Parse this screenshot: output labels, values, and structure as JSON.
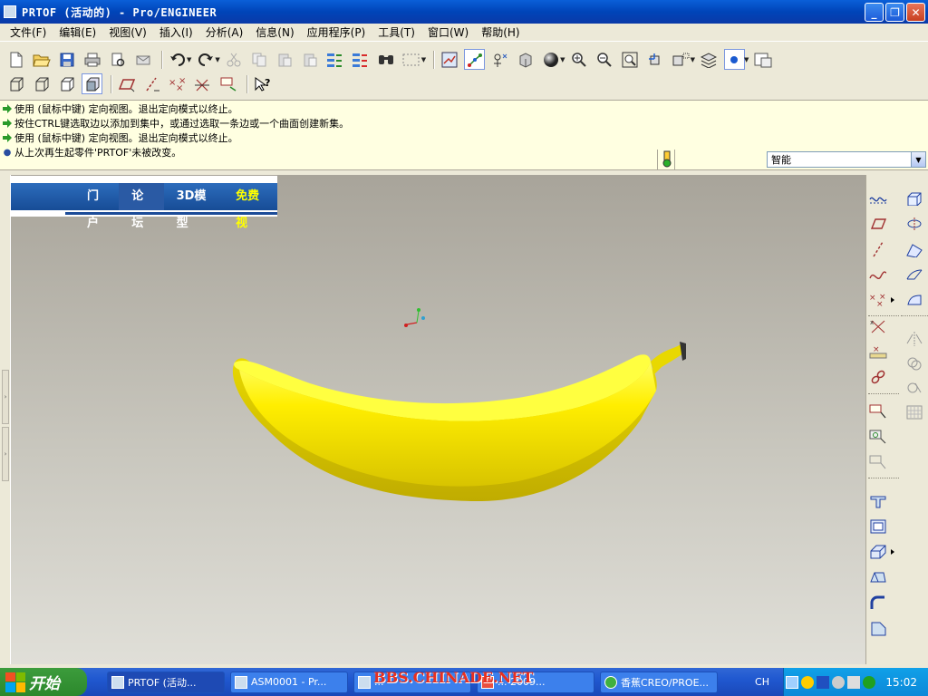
{
  "window": {
    "title": "PRTOF (活动的) - Pro/ENGINEER"
  },
  "menu": [
    "文件(F)",
    "编辑(E)",
    "视图(V)",
    "插入(I)",
    "分析(A)",
    "信息(N)",
    "应用程序(P)",
    "工具(T)",
    "窗口(W)",
    "帮助(H)"
  ],
  "messages": {
    "m1": "使用 (鼠标中键) 定向视图。退出定向模式以终止。",
    "m2": "按住CTRL键选取边以添加到集中，或通过选取一条边或一个曲面创建新集。",
    "m3": "使用 (鼠标中键) 定向视图。退出定向模式以终止。",
    "m4": "从上次再生起零件'PRTOF'未被改变。"
  },
  "filter": {
    "value": "智能"
  },
  "banner": {
    "i1": "门户",
    "i2": "论坛",
    "i3": "3D模型",
    "i4": "免费视"
  },
  "taskbar": {
    "start": "开始",
    "t1": "PRTOF (活动...",
    "t2": "ASM0001 - Pr...",
    "t3": "...",
    "t4": "... 2009...",
    "t5": "香蕉CREO/PROE...",
    "lang": "CH",
    "clock": "15:02"
  },
  "watermark": "BBS.CHINADE.NET",
  "colors": {
    "banana": "#ffee00",
    "titlebar": "#0a5fd8",
    "background": "#ece9d8"
  }
}
